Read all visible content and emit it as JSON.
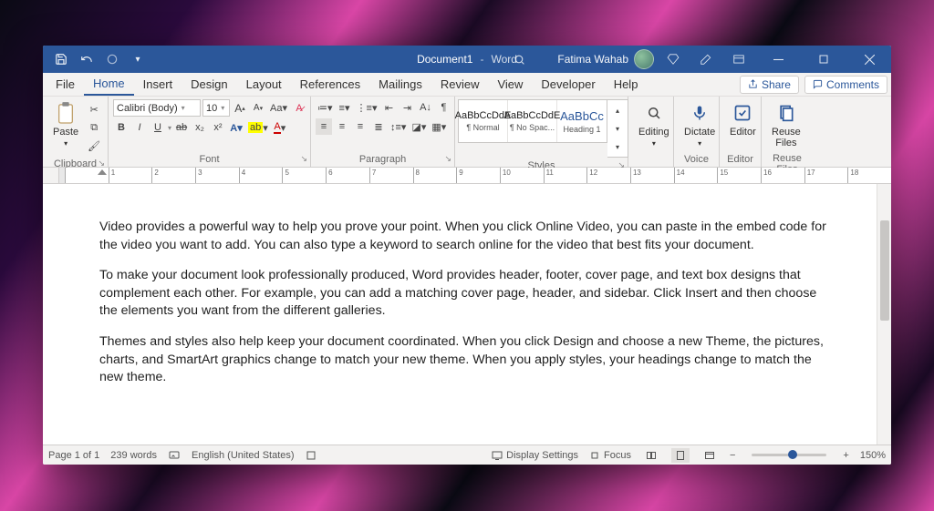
{
  "titlebar": {
    "document_name": "Document1",
    "app_name": "Word",
    "user_name": "Fatima Wahab"
  },
  "tabs": [
    "File",
    "Home",
    "Insert",
    "Design",
    "Layout",
    "References",
    "Mailings",
    "Review",
    "View",
    "Developer",
    "Help"
  ],
  "active_tab": "Home",
  "share_label": "Share",
  "comments_label": "Comments",
  "ribbon": {
    "clipboard": {
      "paste": "Paste",
      "group_label": "Clipboard"
    },
    "font": {
      "font_name": "Calibri (Body)",
      "font_size": "10",
      "group_label": "Font",
      "bold": "B",
      "italic": "I",
      "underline": "U",
      "strike": "ab",
      "sub": "x₂",
      "sup": "x²",
      "effects": "A",
      "highlight": "ab",
      "fontcolor": "A"
    },
    "paragraph": {
      "group_label": "Paragraph"
    },
    "styles": {
      "group_label": "Styles",
      "items": [
        {
          "preview": "AaBbCcDdE",
          "name": "¶ Normal"
        },
        {
          "preview": "AaBbCcDdE",
          "name": "¶ No Spac..."
        },
        {
          "preview": "AaBbCc",
          "name": "Heading 1"
        }
      ]
    },
    "editing": {
      "label": "Editing",
      "group_label": ""
    },
    "voice": {
      "label": "Dictate",
      "group_label": "Voice"
    },
    "editor": {
      "label": "Editor",
      "group_label": "Editor"
    },
    "reuse": {
      "label": "Reuse\nFiles",
      "group_label": "Reuse Files"
    }
  },
  "document": {
    "paragraphs": [
      "Video provides a powerful way to help you prove your point. When you click Online Video, you can paste in the embed code for the video you want to add. You can also type a keyword to search online for the video that best fits your document.",
      "To make your document look professionally produced, Word provides header, footer, cover page, and text box designs that complement each other. For example, you can add a matching cover page, header, and sidebar. Click Insert and then choose the elements you want from the different galleries.",
      "Themes and styles also help keep your document coordinated. When you click Design and choose a new Theme, the pictures, charts, and SmartArt graphics change to match your new theme. When you apply styles, your headings change to match the new theme."
    ]
  },
  "status": {
    "page": "Page 1 of 1",
    "words": "239 words",
    "language": "English (United States)",
    "display_settings": "Display Settings",
    "focus": "Focus",
    "zoom": "150%"
  },
  "ruler_numbers": [
    "",
    "1",
    "2",
    "3",
    "4",
    "5",
    "6",
    "7",
    "8",
    "9",
    "10",
    "11",
    "12",
    "13",
    "14",
    "15",
    "16",
    "17",
    "18"
  ]
}
